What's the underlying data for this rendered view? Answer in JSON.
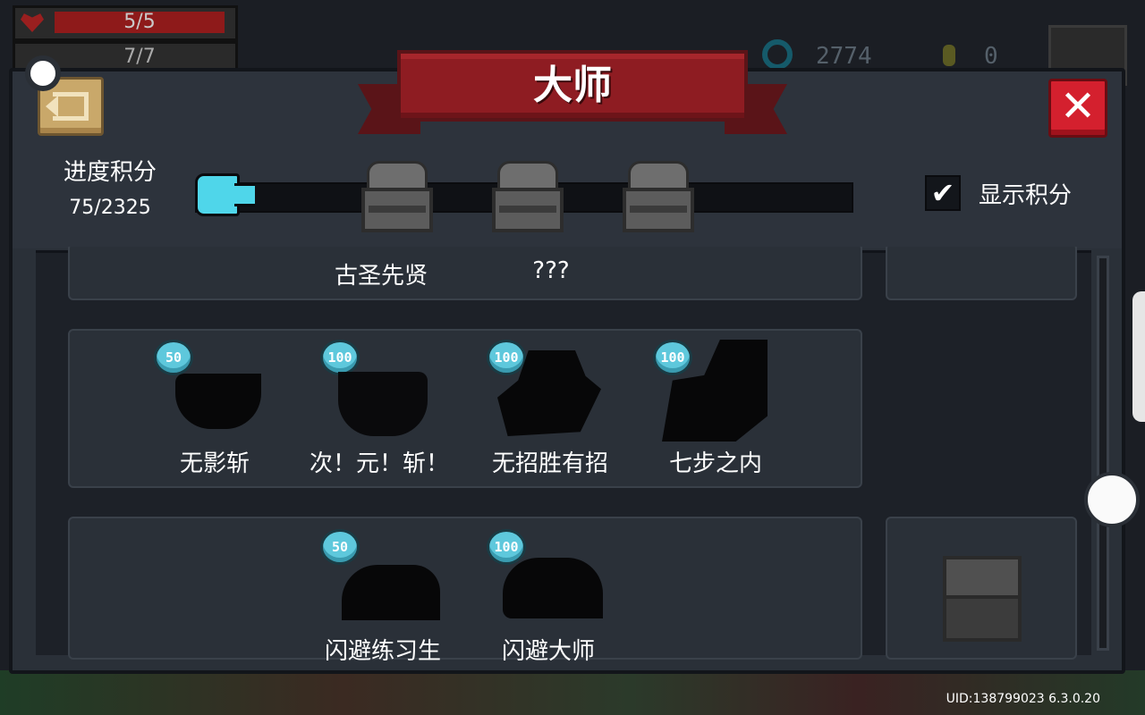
{
  "hud": {
    "hp": "5/5",
    "armor": "7/7",
    "gems": "2774",
    "coins": "0"
  },
  "dialog": {
    "title": "大师",
    "progress_label": "进度积分",
    "progress_value": "75/2325",
    "progress_fraction": 0.032,
    "show_points_label": "显示积分",
    "show_points_checked": true
  },
  "rows": [
    {
      "items": [
        {
          "label": "古圣先贤"
        },
        {
          "label": "???"
        }
      ]
    },
    {
      "items": [
        {
          "badge": "50",
          "label": "无影斩"
        },
        {
          "badge": "100",
          "label": "次！元！斩！"
        },
        {
          "badge": "100",
          "label": "无招胜有招"
        },
        {
          "badge": "100",
          "label": "七步之内"
        }
      ]
    },
    {
      "items": [
        {
          "badge": "50",
          "label": "闪避练习生"
        },
        {
          "badge": "100",
          "label": "闪避大师"
        }
      ]
    }
  ],
  "footer": {
    "uid": "UID:138799023 6.3.0.20"
  },
  "colors": {
    "accent": "#4fd6ea",
    "banner": "#8e1c22",
    "close": "#d4202e"
  },
  "icons": [
    "heart-icon",
    "gem-icon",
    "coin-icon",
    "back-icon",
    "close-icon",
    "check-icon",
    "chest-icon"
  ]
}
